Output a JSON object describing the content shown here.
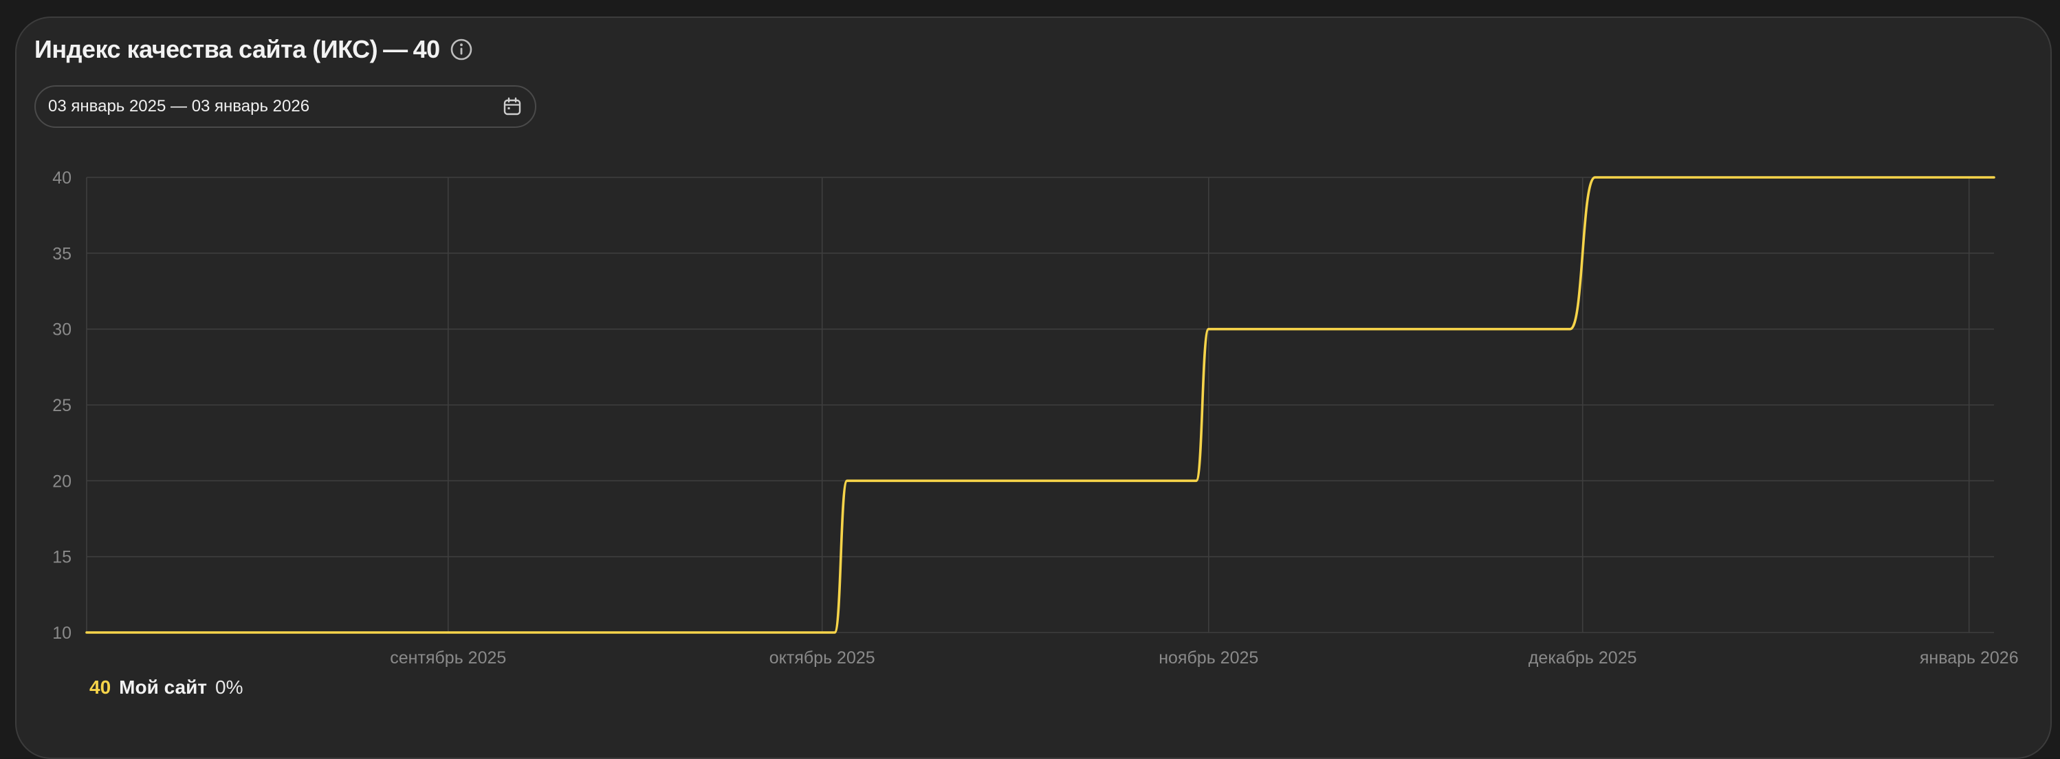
{
  "header": {
    "title": "Индекс качества сайта (ИКС)",
    "dash": "—",
    "current_value": "40",
    "info_icon": "info-circle-icon"
  },
  "date_range": {
    "label": "03 январь 2025 — 03 январь 2026",
    "icon": "calendar-icon"
  },
  "legend": {
    "value": "40",
    "name": "Мой сайт",
    "change": "0%"
  },
  "colors": {
    "background": "#262626",
    "line": "#f6d44a",
    "grid": "#3e3e3e",
    "axis_text": "#8a8a8a"
  },
  "chart_data": {
    "type": "line",
    "title": "",
    "xlabel": "",
    "ylabel": "",
    "ylim": [
      10,
      40
    ],
    "yticks": [
      10,
      15,
      20,
      25,
      30,
      35,
      40
    ],
    "xlim": [
      "2025-08-03",
      "2026-01-03"
    ],
    "xticks": [
      {
        "date": "2025-09-01",
        "label": "сентябрь 2025"
      },
      {
        "date": "2025-10-01",
        "label": "октябрь 2025"
      },
      {
        "date": "2025-11-01",
        "label": "ноябрь 2025"
      },
      {
        "date": "2025-12-01",
        "label": "декабрь 2025"
      },
      {
        "date": "2026-01-01",
        "label": "январь 2026"
      }
    ],
    "grid": true,
    "series": [
      {
        "name": "Мой сайт",
        "color": "#f6d44a",
        "points": [
          {
            "date": "2025-08-03",
            "y": 10
          },
          {
            "date": "2025-10-02",
            "y": 10
          },
          {
            "date": "2025-10-03",
            "y": 20
          },
          {
            "date": "2025-10-31",
            "y": 20
          },
          {
            "date": "2025-11-01",
            "y": 30
          },
          {
            "date": "2025-11-30",
            "y": 30
          },
          {
            "date": "2025-12-02",
            "y": 40
          },
          {
            "date": "2026-01-03",
            "y": 40
          }
        ]
      }
    ]
  }
}
